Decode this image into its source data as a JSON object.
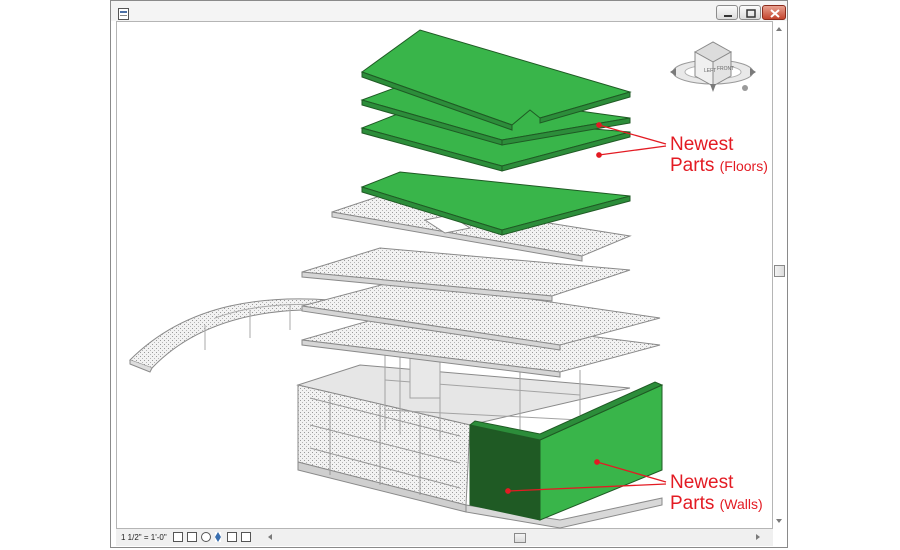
{
  "window": {
    "title_icon": "revit-app-icon",
    "buttons": [
      "minimize",
      "maximize",
      "close"
    ]
  },
  "colors": {
    "green_part": "#39b54a",
    "green_dark": "#1f5a24",
    "callout_red": "#e31b23",
    "ghost_gray": "#c8c8c8"
  },
  "viewcube": {
    "faces": [
      "LEFT",
      "FRONT"
    ]
  },
  "callouts": {
    "floors_line1": "Newest",
    "floors_line2": "Parts",
    "floors_sub": "(Floors)",
    "walls_line1": "Newest",
    "walls_line2": "Parts",
    "walls_sub": "(Walls)"
  },
  "statusbar": {
    "scale": "1 1/2\" = 1'-0\""
  }
}
